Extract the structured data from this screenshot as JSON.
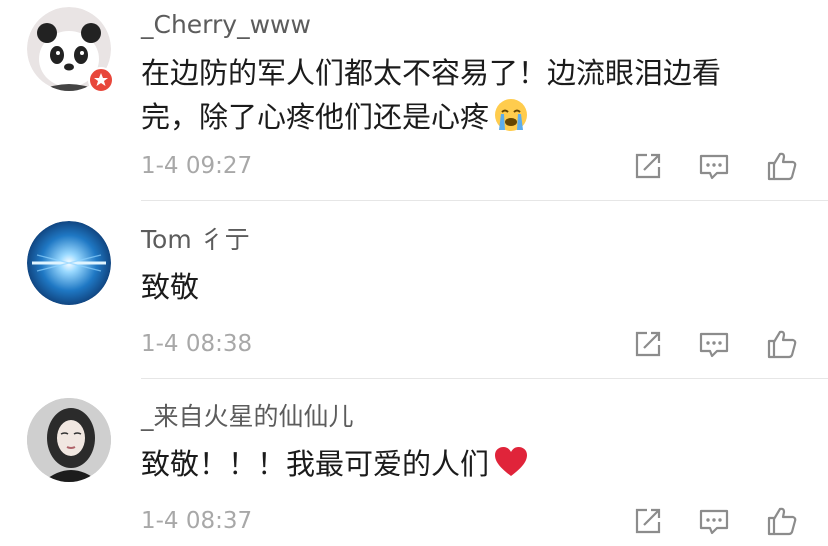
{
  "comments": [
    {
      "username": "_Cherry_www",
      "text_line1": "在边防的军人们都太不容易了！边流眼泪边看",
      "text_line2": "完，除了心疼他们还是心疼",
      "emoji": "crying-face-icon",
      "time": "1-4 09:27",
      "badge": "verified-badge"
    },
    {
      "username": "Tom 彳亍",
      "text_line1": "致敬",
      "time": "1-4 08:38"
    },
    {
      "username": "_来自火星的仙仙儿",
      "text_line1": "致敬！！！我最可爱的人们",
      "emoji": "red-heart-icon",
      "time": "1-4 08:37"
    }
  ],
  "actions": {
    "forward": "share-icon",
    "reply": "comment-icon",
    "like": "thumbs-up-icon"
  },
  "colors": {
    "username": "#5c5c5c",
    "text": "#1b1b1b",
    "time": "#a8a8a8",
    "icon": "#8c8c8c",
    "divider": "#e6e6e6",
    "heart": "#e0243a",
    "badge": "#e8473b"
  }
}
